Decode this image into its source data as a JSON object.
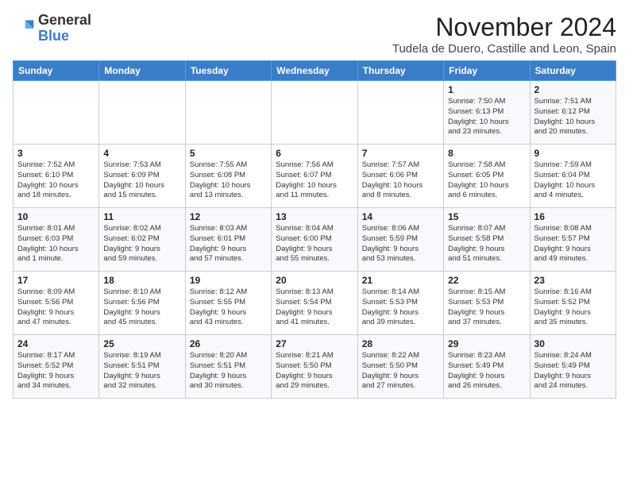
{
  "header": {
    "logo_general": "General",
    "logo_blue": "Blue",
    "month": "November 2024",
    "location": "Tudela de Duero, Castille and Leon, Spain"
  },
  "days_of_week": [
    "Sunday",
    "Monday",
    "Tuesday",
    "Wednesday",
    "Thursday",
    "Friday",
    "Saturday"
  ],
  "weeks": [
    [
      {
        "day": "",
        "info": ""
      },
      {
        "day": "",
        "info": ""
      },
      {
        "day": "",
        "info": ""
      },
      {
        "day": "",
        "info": ""
      },
      {
        "day": "",
        "info": ""
      },
      {
        "day": "1",
        "info": "Sunrise: 7:50 AM\nSunset: 6:13 PM\nDaylight: 10 hours\nand 23 minutes."
      },
      {
        "day": "2",
        "info": "Sunrise: 7:51 AM\nSunset: 6:12 PM\nDaylight: 10 hours\nand 20 minutes."
      }
    ],
    [
      {
        "day": "3",
        "info": "Sunrise: 7:52 AM\nSunset: 6:10 PM\nDaylight: 10 hours\nand 18 minutes."
      },
      {
        "day": "4",
        "info": "Sunrise: 7:53 AM\nSunset: 6:09 PM\nDaylight: 10 hours\nand 15 minutes."
      },
      {
        "day": "5",
        "info": "Sunrise: 7:55 AM\nSunset: 6:08 PM\nDaylight: 10 hours\nand 13 minutes."
      },
      {
        "day": "6",
        "info": "Sunrise: 7:56 AM\nSunset: 6:07 PM\nDaylight: 10 hours\nand 11 minutes."
      },
      {
        "day": "7",
        "info": "Sunrise: 7:57 AM\nSunset: 6:06 PM\nDaylight: 10 hours\nand 8 minutes."
      },
      {
        "day": "8",
        "info": "Sunrise: 7:58 AM\nSunset: 6:05 PM\nDaylight: 10 hours\nand 6 minutes."
      },
      {
        "day": "9",
        "info": "Sunrise: 7:59 AM\nSunset: 6:04 PM\nDaylight: 10 hours\nand 4 minutes."
      }
    ],
    [
      {
        "day": "10",
        "info": "Sunrise: 8:01 AM\nSunset: 6:03 PM\nDaylight: 10 hours\nand 1 minute."
      },
      {
        "day": "11",
        "info": "Sunrise: 8:02 AM\nSunset: 6:02 PM\nDaylight: 9 hours\nand 59 minutes."
      },
      {
        "day": "12",
        "info": "Sunrise: 8:03 AM\nSunset: 6:01 PM\nDaylight: 9 hours\nand 57 minutes."
      },
      {
        "day": "13",
        "info": "Sunrise: 8:04 AM\nSunset: 6:00 PM\nDaylight: 9 hours\nand 55 minutes."
      },
      {
        "day": "14",
        "info": "Sunrise: 8:06 AM\nSunset: 5:59 PM\nDaylight: 9 hours\nand 53 minutes."
      },
      {
        "day": "15",
        "info": "Sunrise: 8:07 AM\nSunset: 5:58 PM\nDaylight: 9 hours\nand 51 minutes."
      },
      {
        "day": "16",
        "info": "Sunrise: 8:08 AM\nSunset: 5:57 PM\nDaylight: 9 hours\nand 49 minutes."
      }
    ],
    [
      {
        "day": "17",
        "info": "Sunrise: 8:09 AM\nSunset: 5:56 PM\nDaylight: 9 hours\nand 47 minutes."
      },
      {
        "day": "18",
        "info": "Sunrise: 8:10 AM\nSunset: 5:56 PM\nDaylight: 9 hours\nand 45 minutes."
      },
      {
        "day": "19",
        "info": "Sunrise: 8:12 AM\nSunset: 5:55 PM\nDaylight: 9 hours\nand 43 minutes."
      },
      {
        "day": "20",
        "info": "Sunrise: 8:13 AM\nSunset: 5:54 PM\nDaylight: 9 hours\nand 41 minutes."
      },
      {
        "day": "21",
        "info": "Sunrise: 8:14 AM\nSunset: 5:53 PM\nDaylight: 9 hours\nand 39 minutes."
      },
      {
        "day": "22",
        "info": "Sunrise: 8:15 AM\nSunset: 5:53 PM\nDaylight: 9 hours\nand 37 minutes."
      },
      {
        "day": "23",
        "info": "Sunrise: 8:16 AM\nSunset: 5:52 PM\nDaylight: 9 hours\nand 35 minutes."
      }
    ],
    [
      {
        "day": "24",
        "info": "Sunrise: 8:17 AM\nSunset: 5:52 PM\nDaylight: 9 hours\nand 34 minutes."
      },
      {
        "day": "25",
        "info": "Sunrise: 8:19 AM\nSunset: 5:51 PM\nDaylight: 9 hours\nand 32 minutes."
      },
      {
        "day": "26",
        "info": "Sunrise: 8:20 AM\nSunset: 5:51 PM\nDaylight: 9 hours\nand 30 minutes."
      },
      {
        "day": "27",
        "info": "Sunrise: 8:21 AM\nSunset: 5:50 PM\nDaylight: 9 hours\nand 29 minutes."
      },
      {
        "day": "28",
        "info": "Sunrise: 8:22 AM\nSunset: 5:50 PM\nDaylight: 9 hours\nand 27 minutes."
      },
      {
        "day": "29",
        "info": "Sunrise: 8:23 AM\nSunset: 5:49 PM\nDaylight: 9 hours\nand 26 minutes."
      },
      {
        "day": "30",
        "info": "Sunrise: 8:24 AM\nSunset: 5:49 PM\nDaylight: 9 hours\nand 24 minutes."
      }
    ]
  ]
}
